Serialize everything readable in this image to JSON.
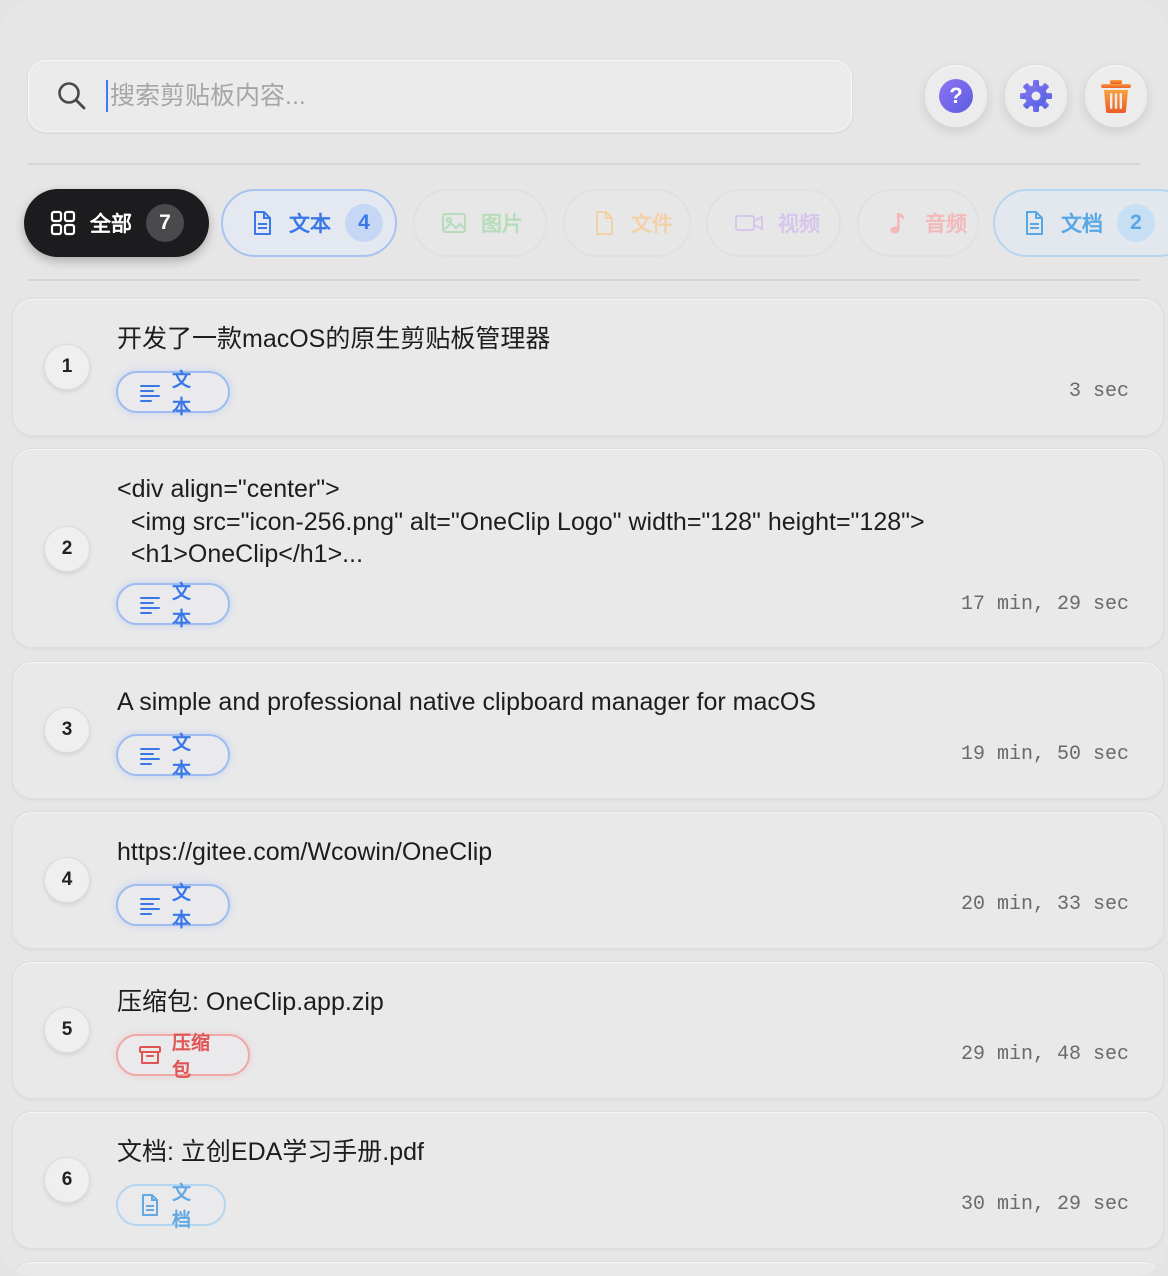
{
  "search": {
    "placeholder": "搜索剪贴板内容..."
  },
  "toolbar": {
    "help_icon": "question-icon",
    "settings_icon": "gear-icon",
    "trash_icon": "trash-icon",
    "help_symbol": "?"
  },
  "filters": [
    {
      "label": "全部",
      "count": "7",
      "icon": "grid-icon"
    },
    {
      "label": "文本",
      "count": "4",
      "icon": "document-icon"
    },
    {
      "label": "图片",
      "icon": "image-icon"
    },
    {
      "label": "文件",
      "icon": "file-icon"
    },
    {
      "label": "视频",
      "icon": "video-icon"
    },
    {
      "label": "音频",
      "icon": "music-icon"
    },
    {
      "label": "文档",
      "count": "2",
      "icon": "document-icon"
    }
  ],
  "items": [
    {
      "index": "1",
      "content": "开发了一款macOS的原生剪贴板管理器",
      "tag": "文本",
      "time": "3 sec"
    },
    {
      "index": "2",
      "content": "<div align=\"center\">\n  <img src=\"icon-256.png\" alt=\"OneClip Logo\" width=\"128\" height=\"128\">\n  <h1>OneClip</h1>...",
      "tag": "文本",
      "time": "17 min, 29 sec"
    },
    {
      "index": "3",
      "content": "A simple and professional native clipboard manager for macOS",
      "tag": "文本",
      "time": "19 min, 50 sec"
    },
    {
      "index": "4",
      "content": "https://gitee.com/Wcowin/OneClip",
      "tag": "文本",
      "time": "20 min, 33 sec"
    },
    {
      "index": "5",
      "content": "压缩包: OneClip.app.zip",
      "tag": "压缩包",
      "time": "29 min, 48 sec"
    },
    {
      "index": "6",
      "content": "文档: 立创EDA学习手册.pdf",
      "tag": "文档",
      "time": "30 min, 29 sec"
    }
  ],
  "colors": {
    "accent_blue": "#3a78e8",
    "zip_red": "#e05454",
    "doc_blue": "#62a9e3",
    "trash_orange": "#f07a2c",
    "gear_purple": "#6d6ae6"
  }
}
